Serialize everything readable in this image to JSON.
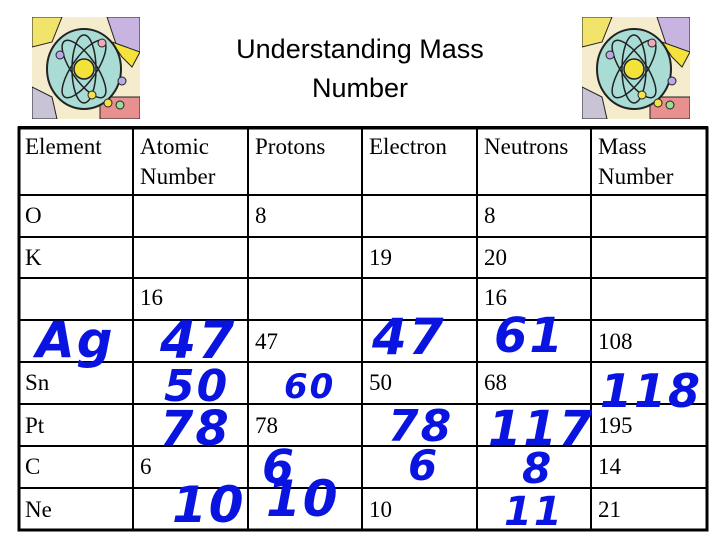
{
  "slide": {
    "title": "Understanding Mass Number",
    "title_line1": "Understanding Mass",
    "title_line2": "Number",
    "decorations": [
      "atom-clipart-left",
      "atom-clipart-right"
    ]
  },
  "table": {
    "headers": [
      "Element",
      "Atomic\nNumber",
      "Protons",
      "Electron",
      "Neutrons",
      "Mass\nNumber"
    ],
    "rows": [
      {
        "element": "O",
        "atomic_number": "",
        "protons": "8",
        "electron": "",
        "neutrons": "8",
        "mass_number": ""
      },
      {
        "element": "K",
        "atomic_number": "",
        "protons": "",
        "electron": "19",
        "neutrons": "20",
        "mass_number": ""
      },
      {
        "element": "",
        "atomic_number": "16",
        "protons": "",
        "electron": "",
        "neutrons": "16",
        "mass_number": ""
      },
      {
        "element": "",
        "atomic_number": "",
        "protons": "47",
        "electron": "",
        "neutrons": "",
        "mass_number": "108"
      },
      {
        "element": "Sn",
        "atomic_number": "",
        "protons": "",
        "electron": "50",
        "neutrons": "68",
        "mass_number": ""
      },
      {
        "element": "Pt",
        "atomic_number": "",
        "protons": "78",
        "electron": "",
        "neutrons": "",
        "mass_number": "195"
      },
      {
        "element": "C",
        "atomic_number": "6",
        "protons": "",
        "electron": "",
        "neutrons": "",
        "mass_number": "14"
      },
      {
        "element": "Ne",
        "atomic_number": "",
        "protons": "",
        "electron": "10",
        "neutrons": "",
        "mass_number": "21"
      }
    ]
  },
  "handwritten_answers": {
    "color": "#0a14e0",
    "items": [
      {
        "row": "Ag",
        "column": "element",
        "text": "Ag"
      },
      {
        "row": "Ag",
        "column": "atomic_number",
        "text": "47"
      },
      {
        "row": "Ag",
        "column": "electron",
        "text": "47"
      },
      {
        "row": "Ag",
        "column": "neutrons",
        "text": "61"
      },
      {
        "row": "Sn",
        "column": "atomic_number",
        "text": "50"
      },
      {
        "row": "Sn",
        "column": "protons",
        "text": "60"
      },
      {
        "row": "Sn",
        "column": "mass_number",
        "text": "118"
      },
      {
        "row": "Pt",
        "column": "atomic_number",
        "text": "78"
      },
      {
        "row": "Pt",
        "column": "electron",
        "text": "78"
      },
      {
        "row": "Pt",
        "column": "neutrons",
        "text": "117"
      },
      {
        "row": "C",
        "column": "protons",
        "text": "6"
      },
      {
        "row": "C",
        "column": "electron",
        "text": "6"
      },
      {
        "row": "C",
        "column": "neutrons",
        "text": "8"
      },
      {
        "row": "Ne",
        "column": "atomic_number",
        "text": "10"
      },
      {
        "row": "Ne",
        "column": "protons",
        "text": "10"
      },
      {
        "row": "Ne",
        "column": "neutrons",
        "text": "11"
      }
    ]
  }
}
